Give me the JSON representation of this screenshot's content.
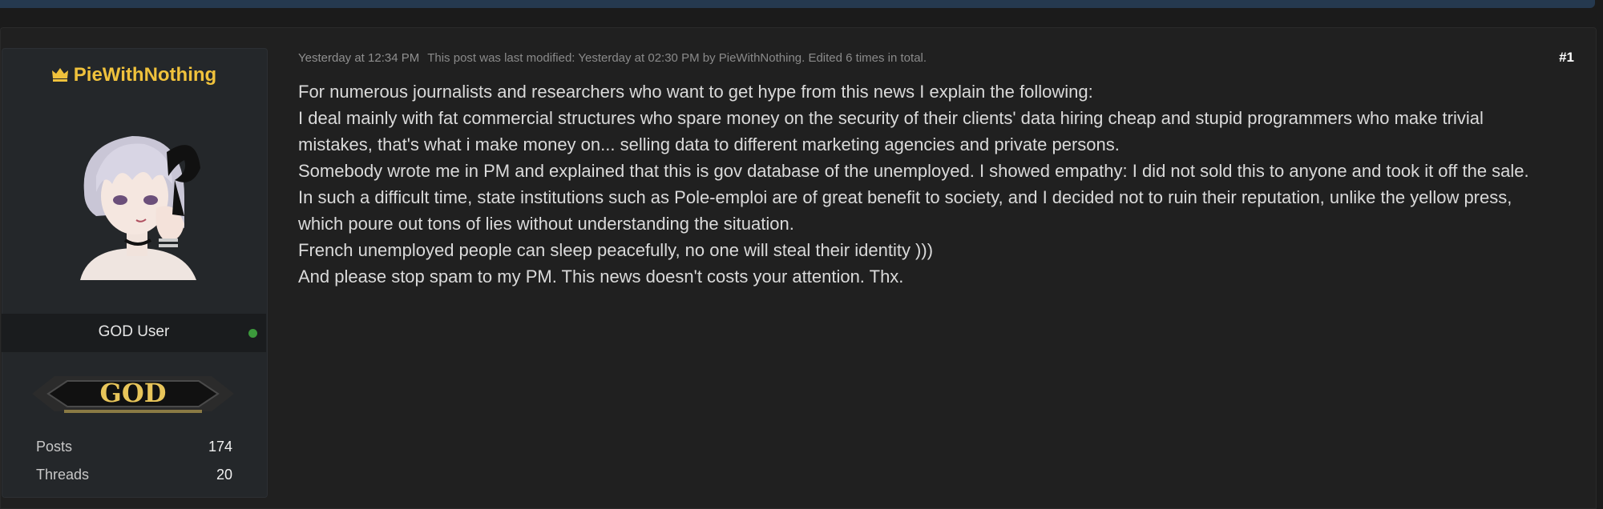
{
  "user": {
    "name": "PieWithNothing",
    "crown_icon": "crown-icon",
    "rank": "GOD User",
    "online_color": "#3c9a3c",
    "badge_text": "GOD",
    "stats": [
      {
        "label": "Posts",
        "value": "174"
      },
      {
        "label": "Threads",
        "value": "20"
      }
    ]
  },
  "post": {
    "time": "Yesterday at 12:34 PM",
    "modified": "This post was last modified: Yesterday at 02:30 PM by PieWithNothing. Edited 6 times in total.",
    "number": "#1",
    "lines": [
      "For numerous journalists and researchers who want to get hype from this news I explain the following:",
      "I deal mainly with fat commercial structures who spare money on the security of their clients' data hiring cheap and stupid programmers who make trivial mistakes, that's what i make money on... selling data to different marketing agencies and private persons.",
      "Somebody wrote me in PM and explained that this is gov database of the unemployed. I showed empathy: I did not sold this to anyone and took it off the sale.",
      "In such a difficult time, state institutions such as Pole-emploi are of great benefit to society, and I decided not to ruin their reputation, unlike the yellow press, which poure out tons of lies without understanding the situation.",
      "French unemployed people can sleep peacefully, no one will steal their identity )))",
      "And please stop spam to my PM. This news doesn't costs your attention. Thx."
    ]
  },
  "colors": {
    "accent": "#f0c23c",
    "background": "#202020",
    "text": "#dadada"
  }
}
